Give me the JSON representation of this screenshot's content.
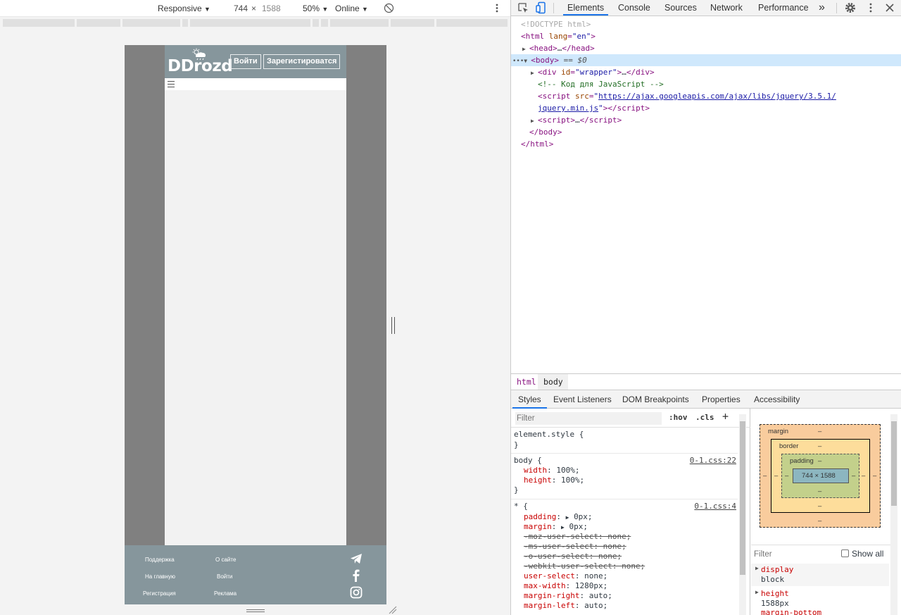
{
  "device_toolbar": {
    "device": "Responsive",
    "width": "744",
    "times": "×",
    "height": "1588",
    "zoom": "50%",
    "network": "Online"
  },
  "site": {
    "logo": "DDrozd",
    "login_button": "Войти",
    "register_button": "Зарегистироватся",
    "footer": {
      "support": "Поддержка",
      "about": "О сайте",
      "home": "На главную",
      "login": "Войти",
      "register": "Регистрация",
      "ads": "Реклама"
    }
  },
  "devtools": {
    "tabs": [
      "Elements",
      "Console",
      "Sources",
      "Network",
      "Performance"
    ],
    "more_tabs": "»",
    "dom": {
      "doctype": "<!DOCTYPE html>",
      "html_open_tag": "html",
      "html_attr_name": "lang",
      "html_attr_value": "\"en\"",
      "head": "head",
      "head_ellipsis": "…",
      "body": "body",
      "body_marker": "== $0",
      "div_tag": "div",
      "div_attr_name": "id",
      "div_attr_value": "\"wrapper\"",
      "comment": "<!-- Код для JavaScript -->",
      "script_tag": "script",
      "script_attr_name": "src",
      "script_src_1": "https://ajax.googleapis.com/ajax/libs/jquery/3.5.1/",
      "script_src_2": "jquery.min.js",
      "body_close": "body",
      "html_close": "html",
      "dots": "•••"
    },
    "breadcrumbs": [
      "html",
      "body"
    ],
    "sub_tabs": [
      "Styles",
      "Event Listeners",
      "DOM Breakpoints",
      "Properties",
      "Accessibility"
    ],
    "styles": {
      "filter_placeholder": "Filter",
      "hov": ":hov",
      "cls": ".cls",
      "plus": "+",
      "element_style": "element.style {",
      "close_brace": "}",
      "body_selector": "body {",
      "body_src": "0-1.css:22",
      "width_prop": "width",
      "width_val": "100%;",
      "height_prop": "height",
      "height_val": "100%;",
      "star_selector": "* {",
      "star_src": "0-1.css:4",
      "padding_prop": "padding",
      "padding_val": "0px;",
      "margin_prop": "margin",
      "margin_val": "0px;",
      "moz": "-moz-user-select: none;",
      "ms": "-ms-user-select: none;",
      "o": "-o-user-select: none;",
      "webkit": "-webkit-user-select: none;",
      "user_select_prop": "user-select",
      "user_select_val": "none;",
      "max_width_prop": "max-width",
      "max_width_val": "1280px;",
      "margin_right_prop": "margin-right",
      "margin_right_val": "auto;",
      "margin_left_prop": "margin-left",
      "margin_left_val": "auto;"
    },
    "box_model": {
      "margin": "margin",
      "border": "border",
      "padding": "padding",
      "dash": "–",
      "content": "744 × 1588"
    },
    "computed": {
      "filter_placeholder": "Filter",
      "show_all": "Show all",
      "display_prop": "display",
      "display_val": "block",
      "height_prop": "height",
      "height_val": "1588px",
      "margin_bottom_prop": "margin-bottom"
    }
  },
  "colors": {
    "accent": "#1a73e8",
    "site_header": "#86969c",
    "device_frame": "#808080",
    "selected_row": "#cfe8fc"
  }
}
